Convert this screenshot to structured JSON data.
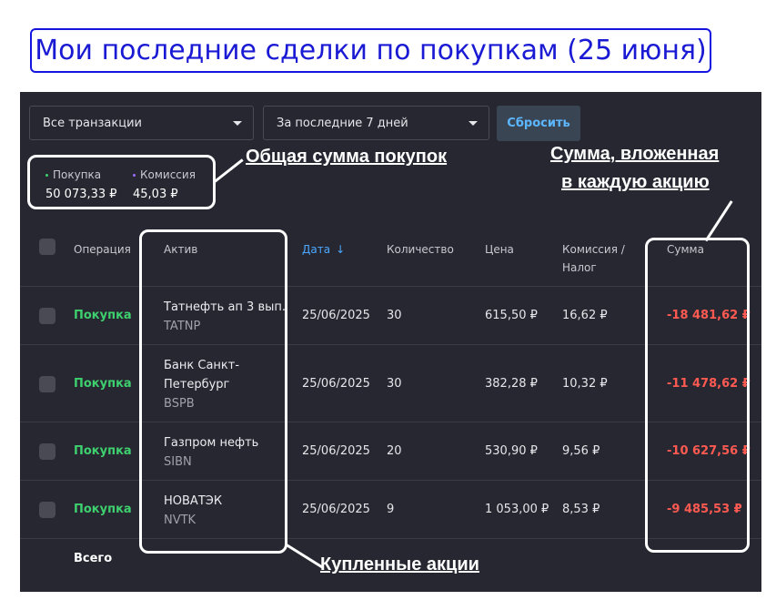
{
  "headline": "Мои последние сделки по покупкам (25 июня)",
  "filters": {
    "transactions": "Все транзакции",
    "period": "За последние 7 дней",
    "reset": "Сбросить"
  },
  "totals": {
    "purchase_label": "Покупка",
    "purchase_value": "50 073,33 ₽",
    "fee_label": "Комиссия",
    "fee_value": "45,03 ₽",
    "purchase_dot_color": "#3ecf6e",
    "fee_dot_color": "#9a6cff"
  },
  "table": {
    "headers": {
      "operation": "Операция",
      "asset": "Актив",
      "date": "Дата",
      "quantity": "Количество",
      "price": "Цена",
      "fee_line1": "Комиссия /",
      "fee_line2": "Налог",
      "sum": "Сумма"
    },
    "rows": [
      {
        "operation": "Покупка",
        "asset_name": "Татнефть ап 3 вып.",
        "ticker": "TATNP",
        "date": "25/06/2025",
        "quantity": "30",
        "price": "615,50 ₽",
        "fee": "16,62 ₽",
        "sum": "-18 481,62 ₽"
      },
      {
        "operation": "Покупка",
        "asset_name_line1": "Банк Санкт-",
        "asset_name_line2": "Петербург",
        "ticker": "BSPB",
        "date": "25/06/2025",
        "quantity": "30",
        "price": "382,28 ₽",
        "fee": "10,32 ₽",
        "sum": "-11 478,62 ₽"
      },
      {
        "operation": "Покупка",
        "asset_name": "Газпром нефть",
        "ticker": "SIBN",
        "date": "25/06/2025",
        "quantity": "20",
        "price": "530,90 ₽",
        "fee": "9,56 ₽",
        "sum": "-10 627,56 ₽"
      },
      {
        "operation": "Покупка",
        "asset_name": "НОВАТЭК",
        "ticker": "NVTK",
        "date": "25/06/2025",
        "quantity": "9",
        "price": "1 053,00 ₽",
        "fee": "8,53 ₽",
        "sum": "-9 485,53 ₽"
      }
    ],
    "total_label": "Всего"
  },
  "annotations": {
    "total_purchases": "Общая сумма покупок",
    "sum_per_share_line1": "Сумма, вложенная",
    "sum_per_share_line2": "в каждую акцию",
    "bought_shares": "Купленные акции"
  },
  "colors": {
    "panel_bg": "#272731",
    "accent_blue": "#4aa8ff",
    "buy_green": "#3ecf6e",
    "negative_red": "#ff5a52",
    "headline_blue": "#1a1ad4"
  }
}
